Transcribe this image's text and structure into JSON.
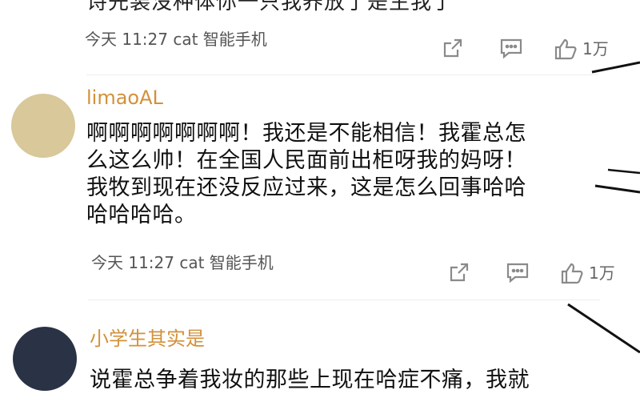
{
  "colors": {
    "username": "#d2913a",
    "meta": "#555555",
    "icon": "#8a8a8a"
  },
  "comments": [
    {
      "partial_text": "诗先装没种体你一只我养放了是生我了",
      "timestamp": "今天 11:27 cat 智能手机",
      "likes": "1万",
      "icons": [
        "share-icon",
        "reply-icon",
        "thumbs-up-icon"
      ]
    },
    {
      "username": "limaoAL",
      "avatar_color": "#d8c89a",
      "lines": [
        "啊啊啊啊啊啊啊！我还是不能相信！我霍总怎",
        "么这么帅！在全国人民面前出柜呀我的妈呀！",
        "我牧到现在还没反应过来，这是怎么回事哈哈",
        "哈哈哈哈。"
      ],
      "timestamp": "今天 11:27 cat 智能手机",
      "likes": "1万",
      "icons": [
        "share-icon",
        "reply-icon",
        "thumbs-up-icon"
      ]
    },
    {
      "username": "小学生其实是",
      "avatar_color": "#2a3245",
      "partial_text": "说霍总争着我妆的那些上现在哈症不痛，我就"
    }
  ]
}
